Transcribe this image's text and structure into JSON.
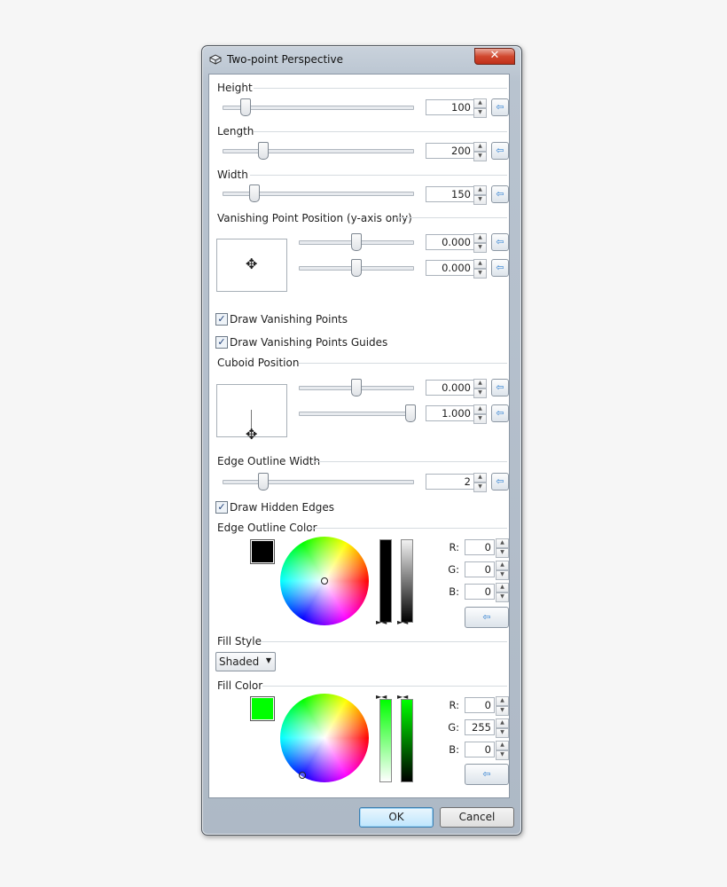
{
  "dialog": {
    "title": "Two-point Perspective",
    "ok_label": "OK",
    "cancel_label": "Cancel",
    "close_label": "✕"
  },
  "height": {
    "label": "Height",
    "value": "100",
    "slider_fraction": 0.1
  },
  "length": {
    "label": "Length",
    "value": "200",
    "slider_fraction": 0.2
  },
  "width": {
    "label": "Width",
    "value": "150",
    "slider_fraction": 0.15
  },
  "vanishing": {
    "label": "Vanishing Point Position (y-axis only)",
    "value1": "0.000",
    "value2": "0.000"
  },
  "checks": {
    "draw_vanishing_points": {
      "label": "Draw Vanishing Points",
      "checked": true
    },
    "draw_vanishing_guides": {
      "label": "Draw Vanishing Points Guides",
      "checked": true
    },
    "draw_hidden_edges": {
      "label": "Draw Hidden Edges",
      "checked": true
    }
  },
  "cuboid": {
    "label": "Cuboid Position",
    "value1": "0.000",
    "value2": "1.000"
  },
  "edge_width": {
    "label": "Edge Outline Width",
    "value": "2"
  },
  "edge_color": {
    "label": "Edge Outline Color",
    "r": "0",
    "g": "0",
    "b": "0",
    "swatch": "#000000"
  },
  "fill_style": {
    "label": "Fill Style",
    "selected": "Shaded"
  },
  "fill_color": {
    "label": "Fill Color",
    "r": "0",
    "g": "255",
    "b": "0",
    "swatch": "#00ff00"
  },
  "rgb_labels": {
    "r": "R:",
    "g": "G:",
    "b": "B:"
  },
  "icons": {
    "reset": "reset-arrow-icon",
    "move": "move-cross-icon",
    "app": "cube-icon"
  }
}
